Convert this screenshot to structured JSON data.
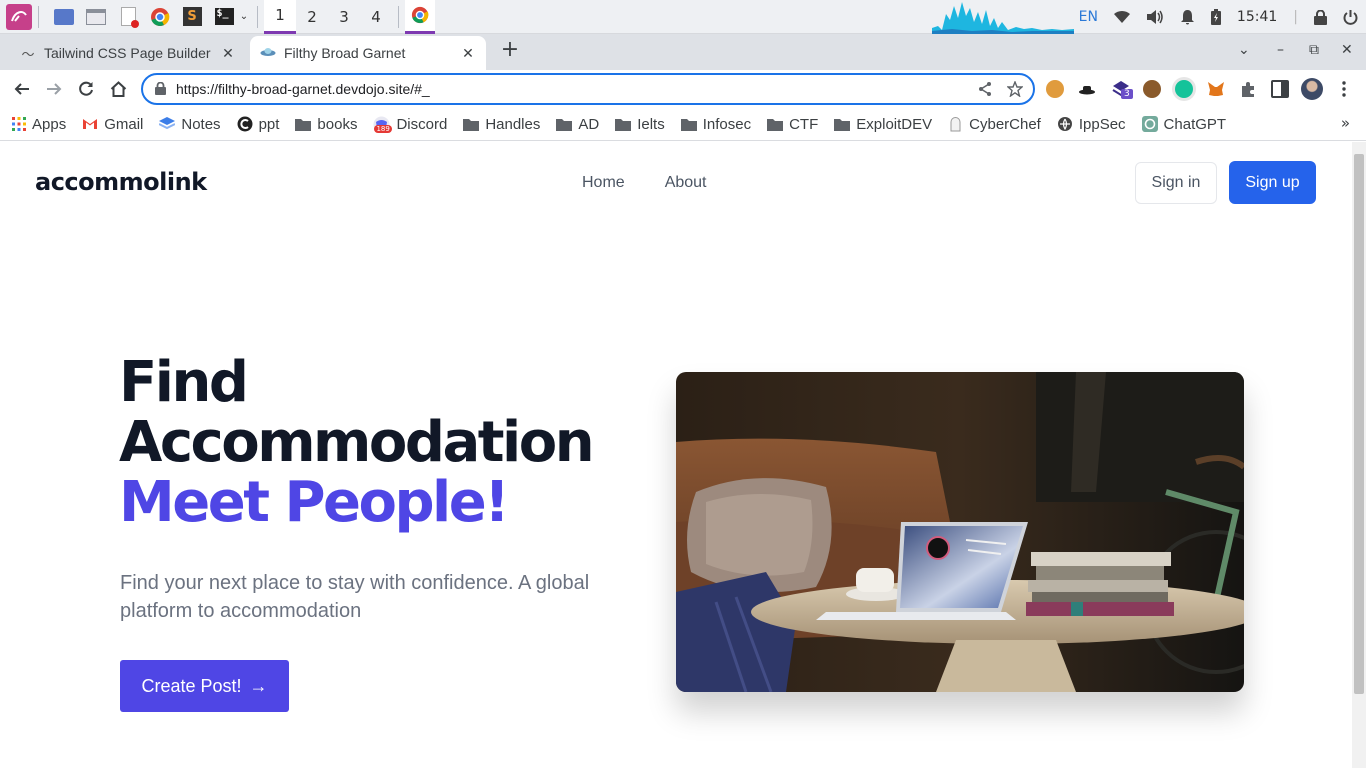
{
  "taskbar": {
    "workspaces": [
      "1",
      "2",
      "3",
      "4"
    ],
    "active_workspace": "1",
    "language": "EN",
    "clock": "15:41"
  },
  "browser": {
    "tabs": [
      {
        "title": "Tailwind CSS Page Builder",
        "icon": "tailwind-icon",
        "active": false
      },
      {
        "title": "Filthy Broad Garnet",
        "icon": "ufo-icon",
        "active": true
      }
    ],
    "url": "https://filthy-broad-garnet.devdojo.site/#_",
    "accent": "#1a73e8"
  },
  "bookmarks": [
    {
      "label": "Apps",
      "icon": "apps-grid-icon"
    },
    {
      "label": "Gmail",
      "icon": "gmail-icon"
    },
    {
      "label": "Notes",
      "icon": "notes-icon"
    },
    {
      "label": "ppt",
      "icon": "ppt-icon"
    },
    {
      "label": "books",
      "icon": "folder-icon"
    },
    {
      "label": "Discord",
      "icon": "discord-icon",
      "badge": "189"
    },
    {
      "label": "Handles",
      "icon": "folder-icon"
    },
    {
      "label": "AD",
      "icon": "folder-icon"
    },
    {
      "label": "Ielts",
      "icon": "folder-icon"
    },
    {
      "label": "Infosec",
      "icon": "folder-icon"
    },
    {
      "label": "CTF",
      "icon": "folder-icon"
    },
    {
      "label": "ExploitDEV",
      "icon": "folder-icon"
    },
    {
      "label": "CyberChef",
      "icon": "cyberchef-icon"
    },
    {
      "label": "IppSec",
      "icon": "ippsec-icon"
    },
    {
      "label": "ChatGPT",
      "icon": "chatgpt-icon"
    }
  ],
  "site": {
    "logo": "accommolink",
    "nav": [
      "Home",
      "About"
    ],
    "signin_label": "Sign in",
    "signup_label": "Sign up",
    "hero": {
      "title_line1": "Find",
      "title_line2": "Accommodation",
      "title_accent": "Meet People!",
      "subtitle": "Find your next place to stay with confidence. A global platform to accommodation",
      "cta_label": "Create Post!",
      "cta_arrow": "→"
    },
    "colors": {
      "primary": "#2563eb",
      "accent": "#4f46e5",
      "heading": "#111827",
      "muted": "#6b7280"
    }
  },
  "extension_badge": "3"
}
